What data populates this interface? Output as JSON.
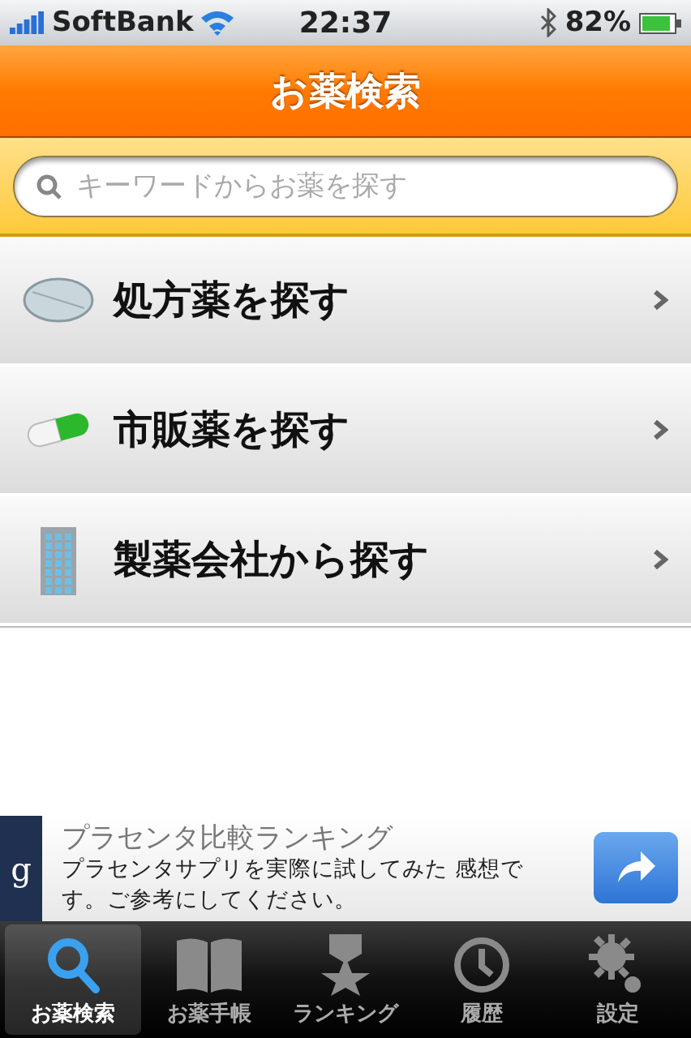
{
  "status_bar": {
    "carrier": "SoftBank",
    "time": "22:37",
    "battery": "82%"
  },
  "nav_bar": {
    "title": "お薬検索"
  },
  "search": {
    "placeholder": "キーワードからお薬を探す"
  },
  "menu": [
    {
      "kind": "tablet",
      "label": "処方薬を探す"
    },
    {
      "kind": "capsule",
      "label": "市販薬を探す"
    },
    {
      "kind": "building",
      "label": "製薬会社から探す"
    }
  ],
  "ad": {
    "badge": "g",
    "title": "プラセンタ比較ランキング",
    "text": "プラセンタサプリを実際に試してみた 感想です。ご参考にしてください。"
  },
  "tabs": [
    {
      "kind": "search",
      "label": "お薬検索",
      "selected": true
    },
    {
      "kind": "book",
      "label": "お薬手帳",
      "selected": false
    },
    {
      "kind": "star",
      "label": "ランキング",
      "selected": false
    },
    {
      "kind": "clock",
      "label": "履歴",
      "selected": false
    },
    {
      "kind": "gear",
      "label": "設定",
      "selected": false
    }
  ]
}
